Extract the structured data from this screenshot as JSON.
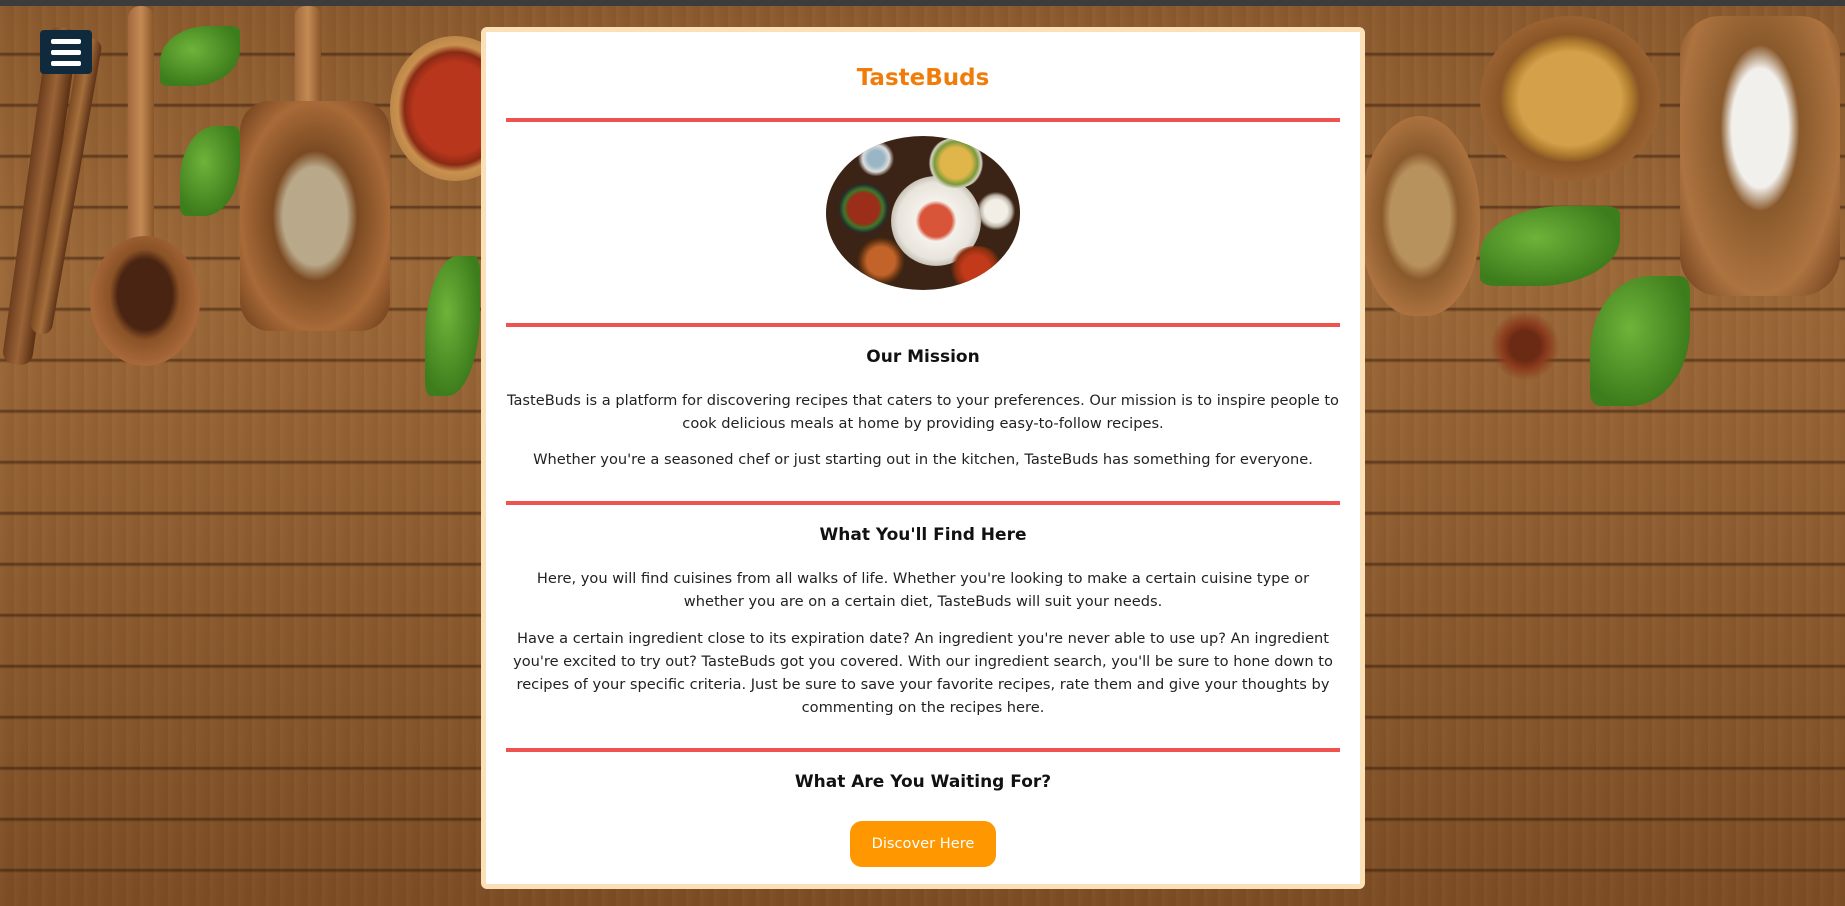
{
  "page": {
    "brand": "TasteBuds"
  },
  "nav": {
    "menu_icon": "hamburger-menu-icon"
  },
  "hero_image": {
    "alt": "Table of plated dishes"
  },
  "sections": {
    "mission": {
      "heading": "Our Mission",
      "paragraph_1": "TasteBuds is a platform for discovering recipes that caters to your preferences. Our mission is to inspire people to cook delicious meals at home by providing easy-to-follow recipes.",
      "paragraph_2": "Whether you're a seasoned chef or just starting out in the kitchen, TasteBuds has something for everyone."
    },
    "find": {
      "heading": "What You'll Find Here",
      "paragraph_1": "Here, you will find cuisines from all walks of life. Whether you're looking to make a certain cuisine type or whether you are on a certain diet, TasteBuds will suit your needs.",
      "paragraph_2": "Have a certain ingredient close to its expiration date? An ingredient you're never able to use up? An ingredient you're excited to try out? TasteBuds got you covered. With our ingredient search, you'll be sure to hone down to recipes of your specific criteria. Just be sure to save your favorite recipes, rate them and give your thoughts by commenting on the recipes here."
    },
    "waiting": {
      "heading": "What Are You Waiting For?",
      "button_label": "Discover Here"
    }
  },
  "colors": {
    "brand": "#f07d0a",
    "divider": "#ef5350",
    "button": "#ff9800",
    "card_border": "#fbe0b8",
    "menu_button": "#0e2a3c"
  }
}
